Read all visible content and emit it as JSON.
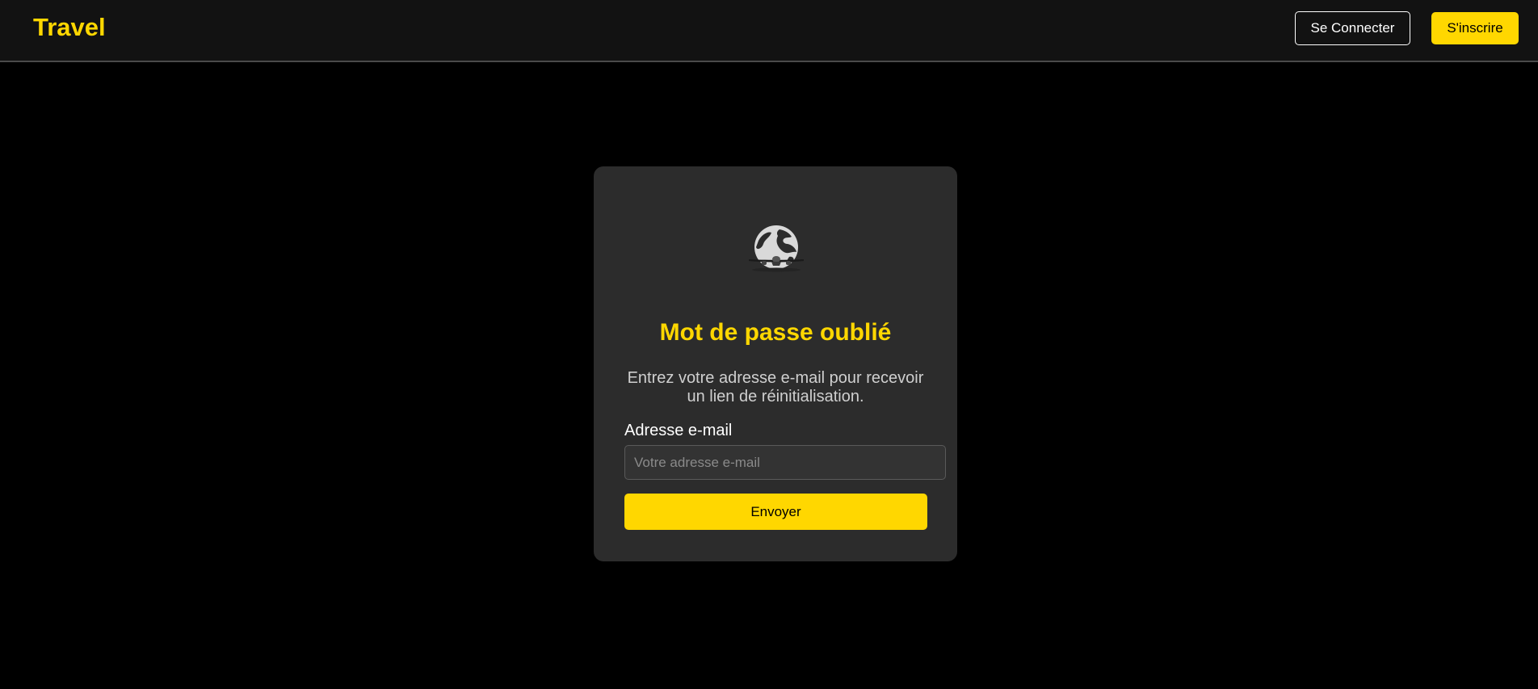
{
  "header": {
    "brand": "Travel",
    "login_label": "Se Connecter",
    "signup_label": "S'inscrire"
  },
  "card": {
    "logo_icon": "globe-airplane-icon",
    "title": "Mot de passe oublié",
    "subtitle": "Entrez votre adresse e-mail pour recevoir un lien de réinitialisation.",
    "email_label": "Adresse e-mail",
    "email_value": "",
    "email_placeholder": "Votre adresse e-mail",
    "submit_label": "Envoyer"
  },
  "colors": {
    "accent": "#ffd700",
    "background": "#000000",
    "navbar": "#121212",
    "card": "#2c2c2c"
  }
}
